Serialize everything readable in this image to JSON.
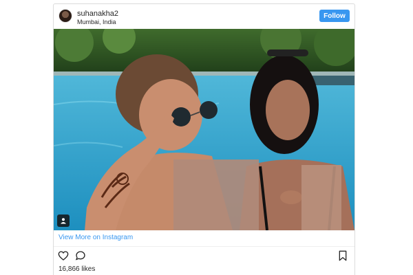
{
  "post": {
    "username": "suhanakha2",
    "location": "Mumbai, India",
    "follow_label": "Follow",
    "view_more_label": "View More on Instagram",
    "likes_text": "16,866 likes"
  },
  "icons": {
    "like": "heart-outline-icon",
    "comment": "speech-bubble-icon",
    "save": "bookmark-icon",
    "carousel": "user-tag-icon"
  },
  "colors": {
    "accent": "#3897f0",
    "border": "#dbdbdb",
    "text": "#262626"
  }
}
